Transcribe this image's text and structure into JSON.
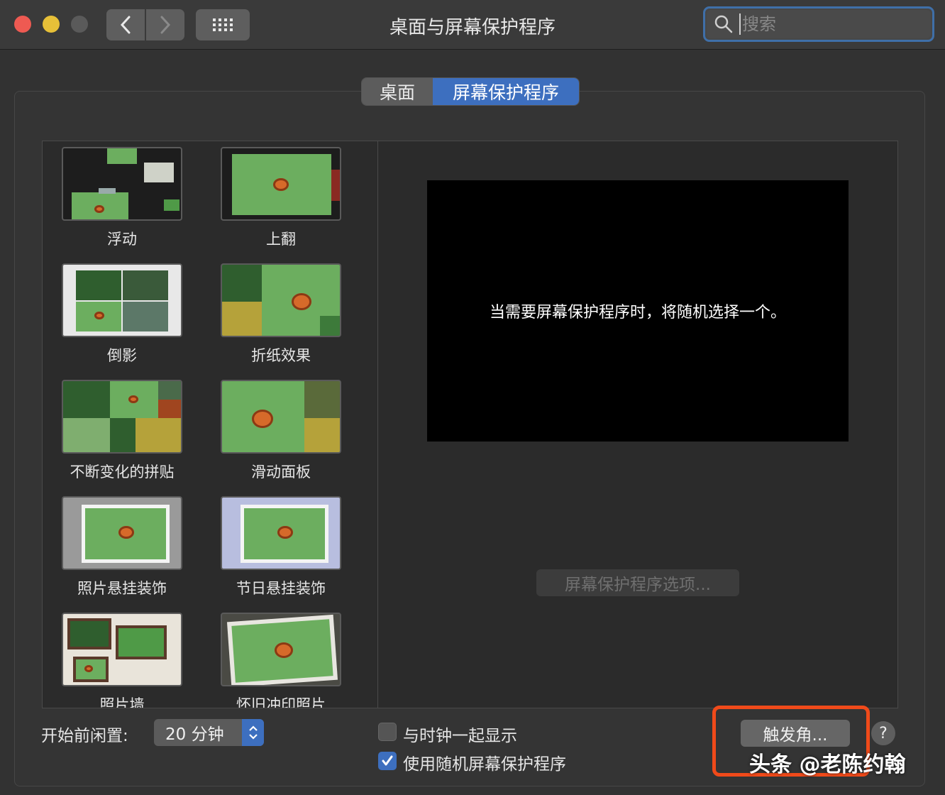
{
  "window": {
    "title": "桌面与屏幕保护程序",
    "search_placeholder": "搜索"
  },
  "tabs": [
    {
      "label": "桌面",
      "selected": false
    },
    {
      "label": "屏幕保护程序",
      "selected": true
    }
  ],
  "savers": [
    {
      "label": "浮动"
    },
    {
      "label": "上翻"
    },
    {
      "label": "倒影"
    },
    {
      "label": "折纸效果"
    },
    {
      "label": "不断变化的拼贴"
    },
    {
      "label": "滑动面板"
    },
    {
      "label": "照片悬挂装饰"
    },
    {
      "label": "节日悬挂装饰"
    },
    {
      "label": "照片墙"
    },
    {
      "label": "怀旧冲印照片"
    }
  ],
  "preview": {
    "message": "当需要屏幕保护程序时，将随机选择一个。",
    "options_button": "屏幕保护程序选项..."
  },
  "bottom": {
    "idle_label": "开始前闲置:",
    "idle_value": "20 分钟",
    "show_clock_label": "与时钟一起显示",
    "show_clock_checked": false,
    "random_label": "使用随机屏幕保护程序",
    "random_checked": true,
    "hot_corners_button": "触发角...",
    "help_label": "?"
  },
  "watermark": "头条 @老陈约翰",
  "colors": {
    "accent": "#3d6fbf",
    "highlight_box": "#f04a1a",
    "close": "#ee5a52",
    "minimize": "#e7c038"
  }
}
